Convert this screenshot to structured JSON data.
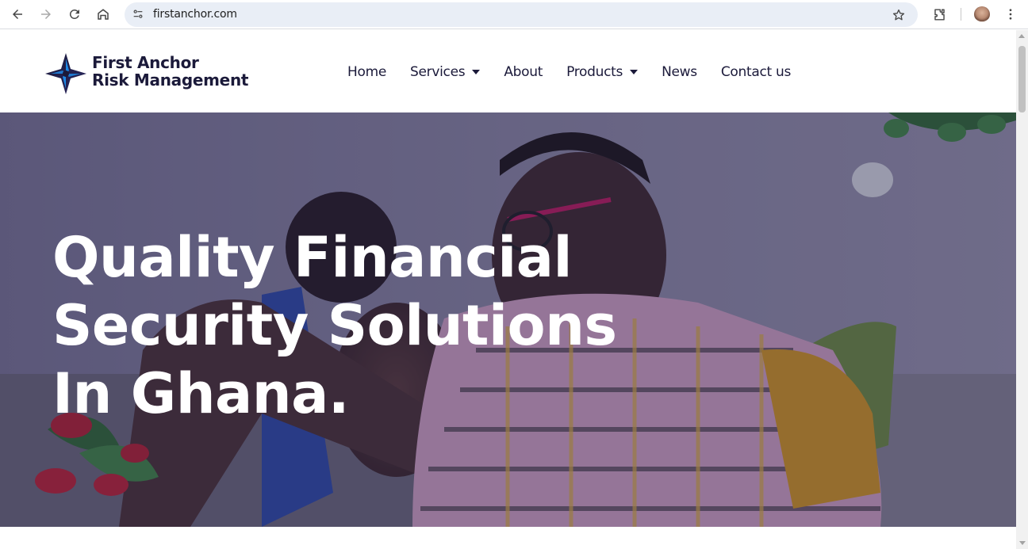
{
  "browser": {
    "url": "firstanchor.com",
    "icons": [
      "back-icon",
      "forward-icon",
      "reload-icon",
      "home-icon",
      "site-info-icon",
      "bookmark-star-icon",
      "extensions-icon",
      "profile-avatar",
      "more-menu-icon"
    ]
  },
  "site": {
    "logo_line1": "First Anchor",
    "logo_line2": "Risk Management",
    "brand_color": "#1b1a3a",
    "accent_color": "#1e88e5"
  },
  "nav": {
    "items": [
      {
        "label": "Home",
        "has_dropdown": false
      },
      {
        "label": "Services",
        "has_dropdown": true
      },
      {
        "label": "About",
        "has_dropdown": false
      },
      {
        "label": "Products",
        "has_dropdown": true
      },
      {
        "label": "News",
        "has_dropdown": false
      },
      {
        "label": "Contact us",
        "has_dropdown": false
      }
    ]
  },
  "hero": {
    "title_line1": "Quality Financial",
    "title_line2": "Security Solutions",
    "title_line3": "In Ghana."
  }
}
